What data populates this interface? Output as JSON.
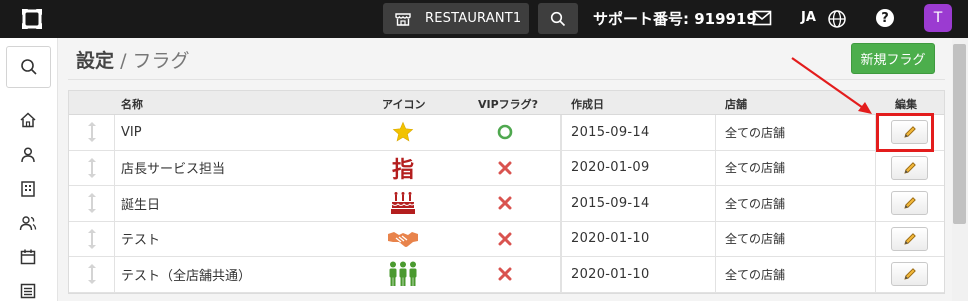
{
  "topbar": {
    "store_name": "RESTAURANT1",
    "support_text": "サポート番号: 919919",
    "language": "JA",
    "help_label": "?",
    "avatar_letter": "T"
  },
  "page": {
    "title": "設定",
    "separator": "/",
    "subtitle": "フラグ",
    "new_button": "新規フラグ"
  },
  "table": {
    "headers": {
      "name": "名称",
      "icon": "アイコン",
      "vip": "VIPフラグ?",
      "created": "作成日",
      "store": "店舗",
      "edit": "編集"
    },
    "rows": [
      {
        "name": "VIP",
        "icon": "star-icon",
        "vip": "yes",
        "created": "2015-09-14",
        "store": "全ての店舗"
      },
      {
        "name": "店長サービス担当",
        "icon": "指",
        "vip": "no",
        "created": "2020-01-09",
        "store": "全ての店舗"
      },
      {
        "name": "誕生日",
        "icon": "birthday-cake-icon",
        "vip": "no",
        "created": "2015-09-14",
        "store": "全ての店舗"
      },
      {
        "name": "テスト",
        "icon": "handshake-icon",
        "vip": "no",
        "created": "2020-01-10",
        "store": "全ての店舗"
      },
      {
        "name": "テスト（全店舗共通）",
        "icon": "people-group-icon",
        "vip": "no",
        "created": "2020-01-10",
        "store": "全ての店舗"
      }
    ]
  },
  "colors": {
    "topbar": "#191919",
    "primary_green": "#4cae4c",
    "avatar": "#9b3bd1",
    "highlight": "#e31c1c",
    "star": "#f2c200",
    "yubi": "#b41e1e",
    "cake": "#b41e1e",
    "handshake": "#e8834b",
    "people": "#4a9a2f",
    "check_green": "#4fa84f",
    "cross_red": "#d9534f"
  }
}
